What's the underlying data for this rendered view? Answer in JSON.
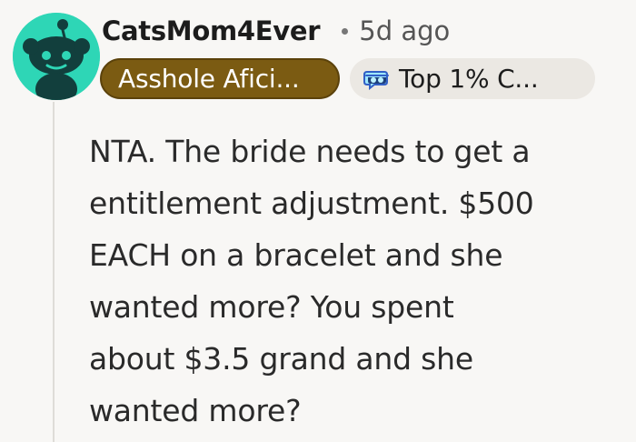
{
  "comment": {
    "author": "CatsMom4Ever",
    "timestamp": "5d ago",
    "author_flair": "Asshole Afici...",
    "achievement_flair": "Top 1% C...",
    "body": "NTA.  The bride needs to get a\nentitlement adjustment. $500\nEACH on a bracelet and she\nwanted more? You spent\nabout $3.5 grand and she\nwanted more?"
  },
  "icons": {
    "avatar": "snoo-avatar",
    "achievement": "top-commenter-badge-icon"
  },
  "colors": {
    "avatar_background": "#2ed6b6",
    "author_flair_background": "#7b5b12",
    "achievement_flair_background": "#ebe8e3"
  }
}
